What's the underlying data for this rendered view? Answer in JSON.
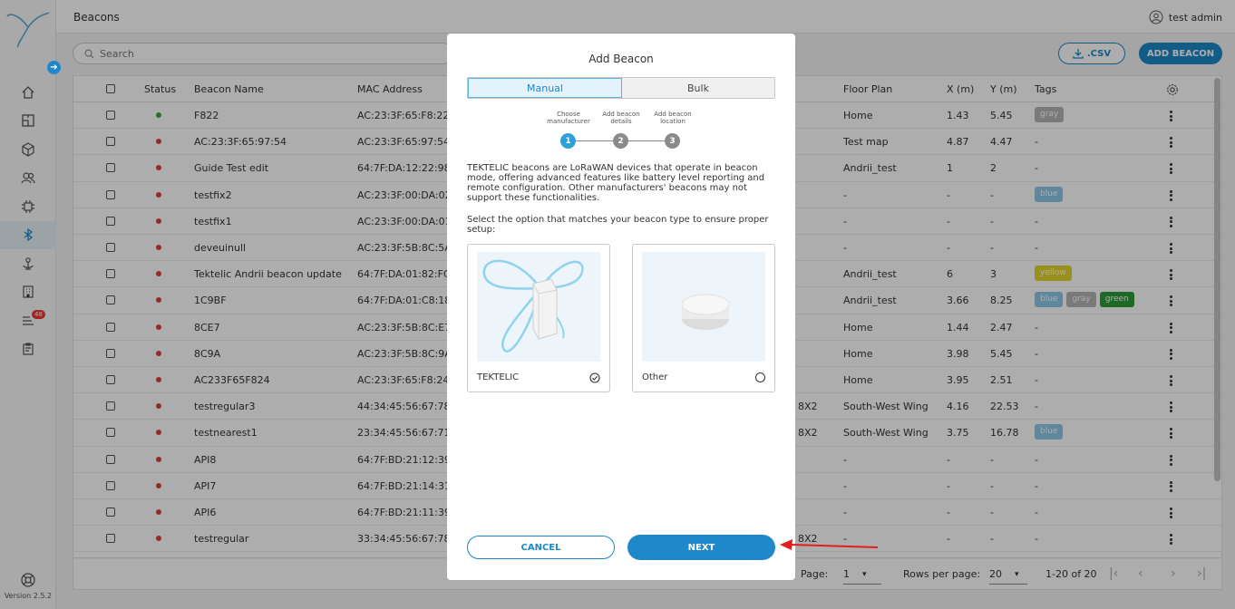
{
  "app": {
    "title": "Beacons",
    "user": "test admin",
    "version": "Version 2.5.2",
    "alert_count": "48"
  },
  "toolbar": {
    "search_placeholder": "Search",
    "csv_label": ".CSV",
    "add_label": "ADD BEACON"
  },
  "table": {
    "columns": [
      "Status",
      "Beacon Name",
      "MAC Address",
      "Floor Plan",
      "X (m)",
      "Y (m)",
      "Tags"
    ],
    "rows": [
      {
        "status": "online",
        "name": "F822",
        "mac": "AC:23:3F:65:F8:22",
        "zone": "",
        "floor": "Home",
        "x": "1.43",
        "y": "5.45",
        "tags": [
          {
            "label": "gray",
            "color": "#b4b4b4"
          }
        ]
      },
      {
        "status": "offline",
        "name": "AC:23:3F:65:97:54",
        "mac": "AC:23:3F:65:97:54",
        "zone": "",
        "floor": "Test map",
        "x": "4.87",
        "y": "4.47",
        "tags_text": "-"
      },
      {
        "status": "offline",
        "name": "Guide Test edit",
        "mac": "64:7F:DA:12:22:98",
        "zone": "",
        "floor": "Andrii_test",
        "x": "1",
        "y": "2",
        "tags_text": "-"
      },
      {
        "status": "offline",
        "name": "testfix2",
        "mac": "AC:23:3F:00:DA:02",
        "zone": "",
        "floor": "-",
        "x": "-",
        "y": "-",
        "tags": [
          {
            "label": "blue",
            "color": "#8cc8e8"
          }
        ]
      },
      {
        "status": "offline",
        "name": "testfix1",
        "mac": "AC:23:3F:00:DA:01",
        "zone": "",
        "floor": "-",
        "x": "-",
        "y": "-",
        "tags_text": "-"
      },
      {
        "status": "offline",
        "name": "deveuinull",
        "mac": "AC:23:3F:5B:8C:5A",
        "zone": "",
        "floor": "-",
        "x": "-",
        "y": "-",
        "tags_text": "-"
      },
      {
        "status": "offline",
        "name": "Tektelic Andrii beacon update",
        "mac": "64:7F:DA:01:82:FC",
        "zone": "",
        "floor": "Andrii_test",
        "x": "6",
        "y": "3",
        "tags": [
          {
            "label": "yellow",
            "color": "#e2d32a"
          }
        ]
      },
      {
        "status": "offline",
        "name": "1C9BF",
        "mac": "64:7F:DA:01:C8:18",
        "zone": "",
        "floor": "Andrii_test",
        "x": "3.66",
        "y": "8.25",
        "tags": [
          {
            "label": "blue",
            "color": "#8cc8e8"
          },
          {
            "label": "gray",
            "color": "#b4b4b4"
          },
          {
            "label": "green",
            "color": "#2e9b3a"
          }
        ]
      },
      {
        "status": "offline",
        "name": "8CE7",
        "mac": "AC:23:3F:5B:8C:E7",
        "zone": "",
        "floor": "Home",
        "x": "1.44",
        "y": "2.47",
        "tags_text": "-"
      },
      {
        "status": "offline",
        "name": "8C9A",
        "mac": "AC:23:3F:5B:8C:9A",
        "zone": "",
        "floor": "Home",
        "x": "3.98",
        "y": "5.45",
        "tags_text": "-"
      },
      {
        "status": "offline",
        "name": "AC233F65F824",
        "mac": "AC:23:3F:65:F8:24",
        "zone": "",
        "floor": "Home",
        "x": "3.95",
        "y": "2.51",
        "tags_text": "-"
      },
      {
        "status": "offline",
        "name": "testregular3",
        "mac": "44:34:45:56:67:78",
        "zone": "8X2",
        "floor": "South-West Wing",
        "x": "4.16",
        "y": "22.53",
        "tags_text": "-"
      },
      {
        "status": "offline",
        "name": "testnearest1",
        "mac": "23:34:45:56:67:71",
        "zone": "8X2",
        "floor": "South-West Wing",
        "x": "3.75",
        "y": "16.78",
        "tags": [
          {
            "label": "blue",
            "color": "#8cc8e8"
          }
        ]
      },
      {
        "status": "offline",
        "name": "API8",
        "mac": "64:7F:BD:21:12:39",
        "zone": "",
        "floor": "-",
        "x": "-",
        "y": "-",
        "tags_text": "-"
      },
      {
        "status": "offline",
        "name": "API7",
        "mac": "64:7F:BD:21:14:31",
        "zone": "",
        "floor": "-",
        "x": "-",
        "y": "-",
        "tags_text": "-"
      },
      {
        "status": "offline",
        "name": "API6",
        "mac": "64:7F:BD:21:11:39",
        "zone": "",
        "floor": "-",
        "x": "-",
        "y": "-",
        "tags_text": "-"
      },
      {
        "status": "offline",
        "name": "testregular",
        "mac": "33:34:45:56:67:78",
        "zone": "8X2",
        "floor": "-",
        "x": "-",
        "y": "-",
        "tags_text": "-"
      }
    ]
  },
  "pagination": {
    "page_label": "Page:",
    "page": "1",
    "rows_label": "Rows per page:",
    "rows": "20",
    "range": "1-20 of 20"
  },
  "modal": {
    "title": "Add Beacon",
    "tab_manual": "Manual",
    "tab_bulk": "Bulk",
    "steps": [
      {
        "num": "1",
        "label": "Choose manufacturer"
      },
      {
        "num": "2",
        "label": "Add beacon details"
      },
      {
        "num": "3",
        "label": "Add beacon location"
      }
    ],
    "description": "TEKTELIC beacons are LoRaWAN devices that operate in beacon mode, offering advanced features like battery level reporting and remote configuration. Other manufacturers' beacons may not support these functionalities.",
    "select_text": "Select the option that matches your beacon type to ensure proper setup:",
    "option_tektelic": "TEKTELIC",
    "option_other": "Other",
    "cancel": "CANCEL",
    "next": "NEXT"
  },
  "colors": {
    "accent": "#1e88c9",
    "online": "#3aa63a",
    "offline": "#d9413d"
  }
}
